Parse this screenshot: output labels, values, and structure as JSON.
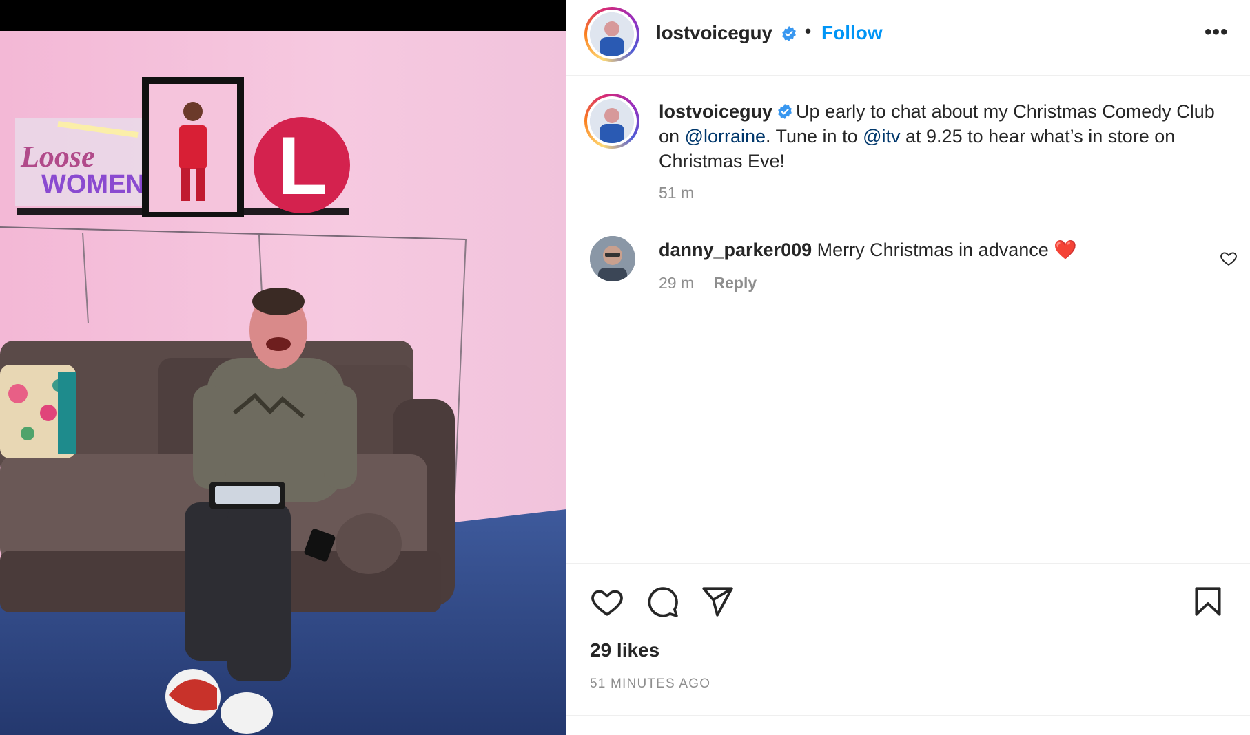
{
  "post": {
    "author": "lostvoiceguy",
    "separator": "•",
    "follow_label": "Follow",
    "more_label": "•••",
    "caption": {
      "username": "lostvoiceguy",
      "text_1": "Up early to chat about my Christmas Comedy Club on ",
      "mention_1": "@lorraine",
      "text_2": ". Tune in to ",
      "mention_2": "@itv",
      "text_3": " at 9.25 to hear what’s in store on Christmas Eve!",
      "time": "51 m"
    },
    "comments": [
      {
        "username": "danny_parker009",
        "text": "Merry Christmas in advance",
        "emoji": "❤️",
        "time": "29 m",
        "reply_label": "Reply"
      }
    ],
    "likes": "29 likes",
    "posted_ago": "51 MINUTES AGO"
  },
  "photo": {
    "sign_loose": "Loose",
    "sign_women": "WOMEN",
    "sign_l": "L"
  },
  "icons": {
    "verified": "verified-badge-icon",
    "like": "heart-icon",
    "comment": "comment-bubble-icon",
    "share": "paper-plane-icon",
    "save": "bookmark-icon"
  },
  "colors": {
    "accent": "#0095f6",
    "mention": "#00376b",
    "muted": "#8e8e8e",
    "verified": "#3897f0"
  }
}
